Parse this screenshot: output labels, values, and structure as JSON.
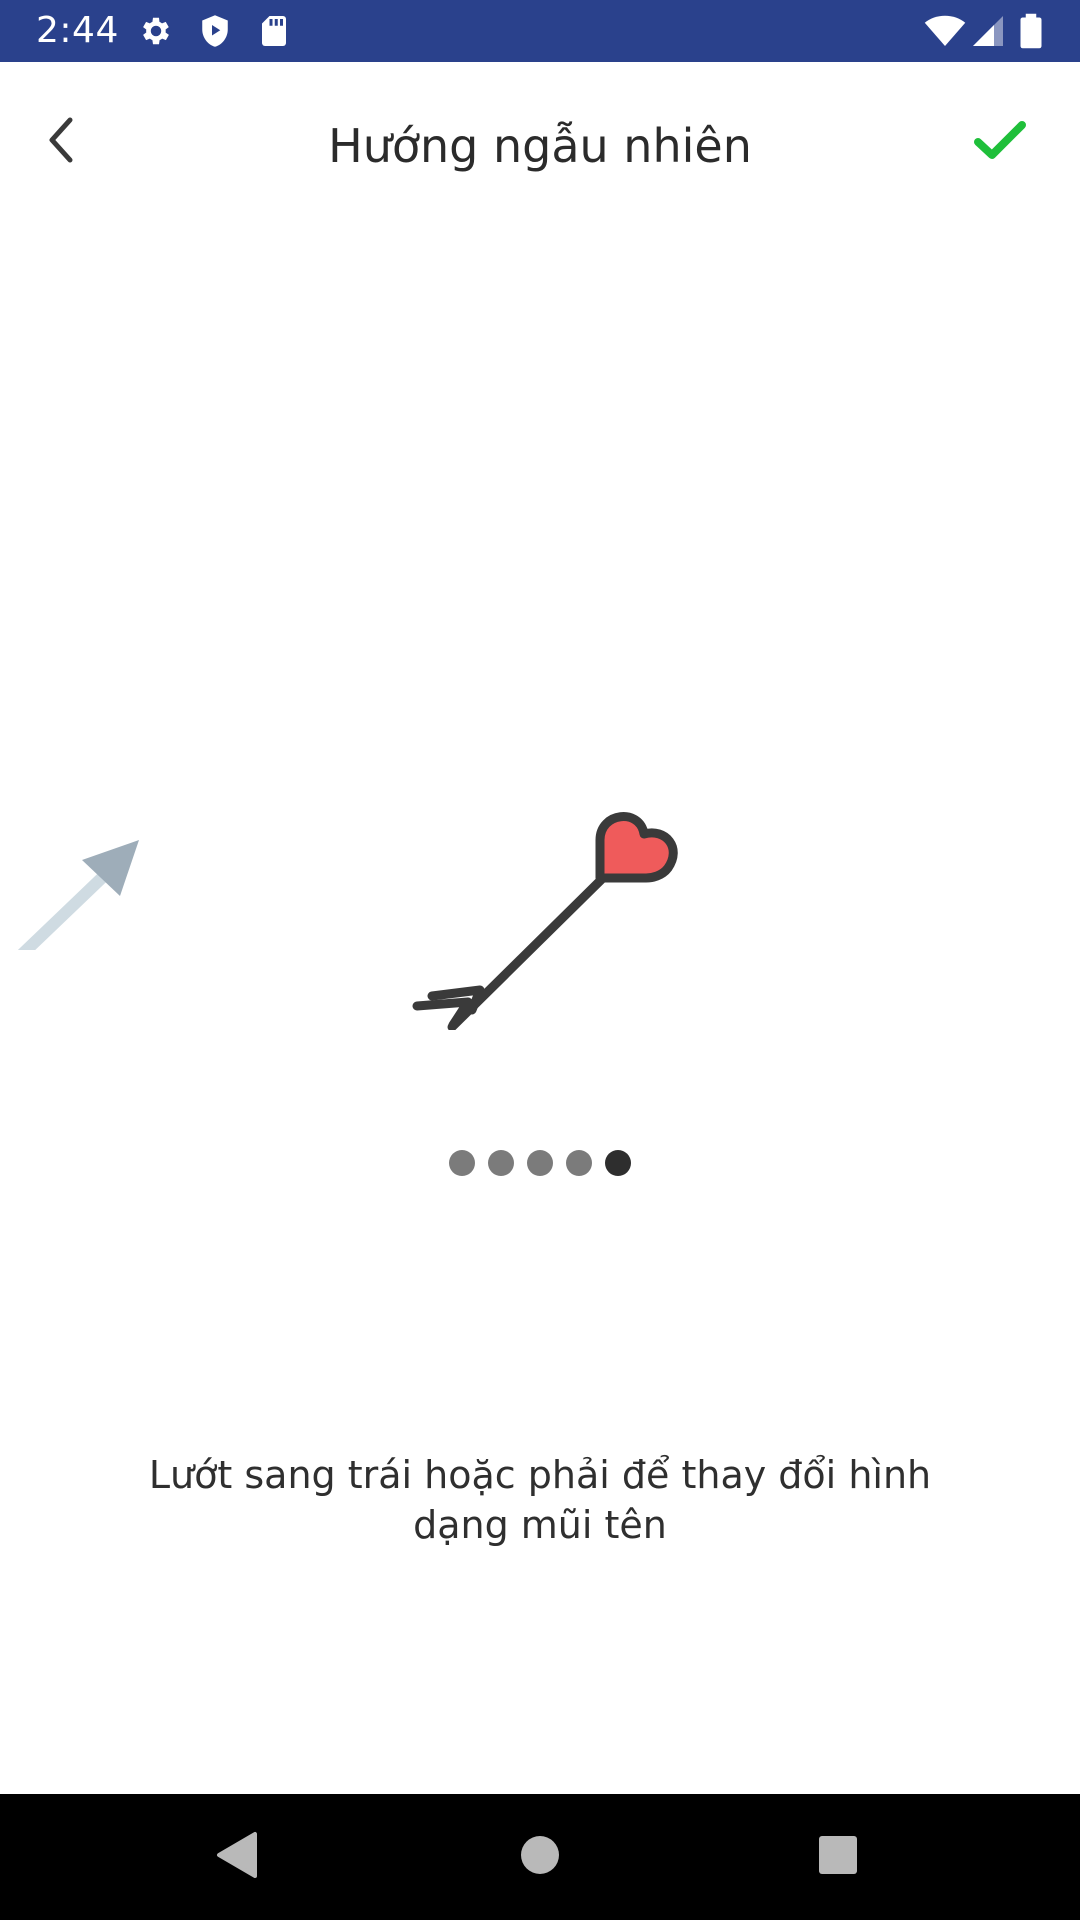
{
  "status_bar": {
    "time": "2:44",
    "background_color": "#2a418c",
    "icons": [
      "settings-icon",
      "shield-play-icon",
      "sd-card-icon",
      "wifi-icon",
      "cellular-signal-icon",
      "battery-icon"
    ]
  },
  "header": {
    "title": "Hướng ngẫu nhiên",
    "back_icon": "chevron-left-icon",
    "confirm_icon": "check-icon",
    "confirm_color": "#1fbf3a"
  },
  "carousel": {
    "current_arrow": "heart-arrow-icon",
    "previous_arrow": "plain-arrow-icon",
    "heart_color": "#ef5b5b",
    "page_count": 5,
    "active_page": 5
  },
  "hint": {
    "text": "Lướt sang trái hoặc phải để thay đổi hình dạng mũi tên"
  },
  "nav_bar": {
    "icons": [
      "nav-back-icon",
      "nav-home-icon",
      "nav-recents-icon"
    ]
  }
}
